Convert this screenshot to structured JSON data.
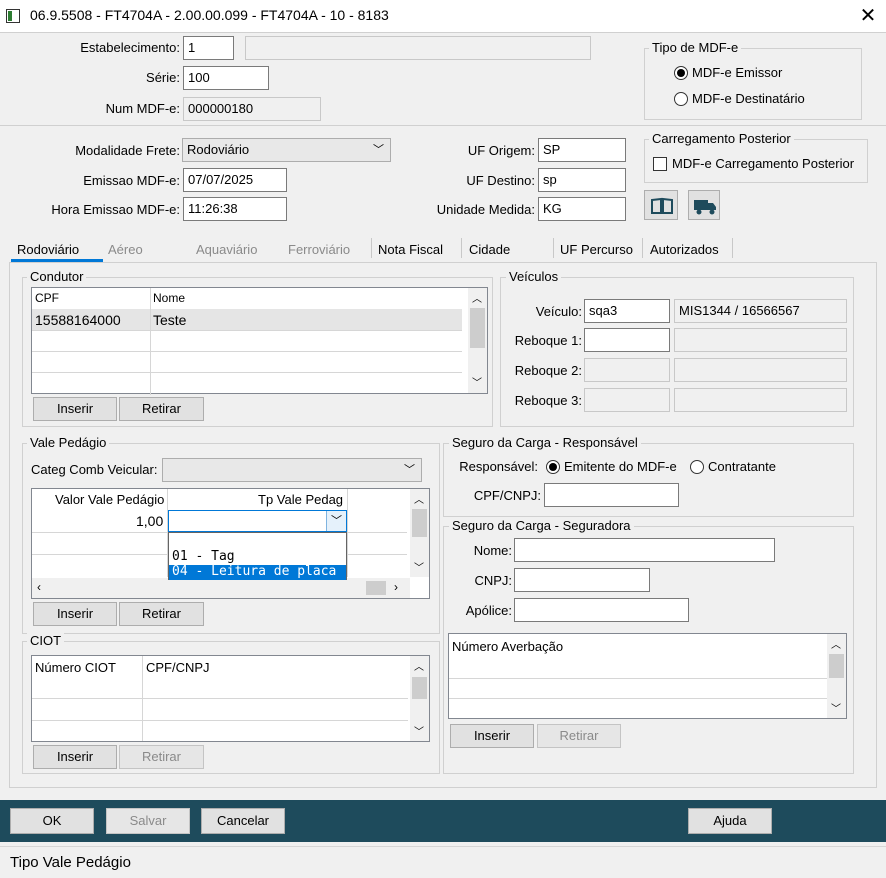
{
  "window": {
    "title": "06.9.5508 - FT4704A - 2.00.00.099 - FT4704A - 10 - 8183"
  },
  "header": {
    "estabelecimento_label": "Estabelecimento:",
    "estabelecimento_value": "1",
    "estabelecimento_desc": "",
    "serie_label": "Série:",
    "serie_value": "100",
    "num_mdfe_label": "Num MDF-e:",
    "num_mdfe_value": "000000180",
    "tipo_mdfe_title": "Tipo de MDF-e",
    "tipo_emissor": "MDF-e Emissor",
    "tipo_destinatario": "MDF-e Destinatário"
  },
  "details": {
    "modalidade_label": "Modalidade Frete:",
    "modalidade_value": "Rodoviário",
    "emissao_label": "Emissao MDF-e:",
    "emissao_value": "07/07/2025",
    "hora_label": "Hora Emissao MDF-e:",
    "hora_value": "11:26:38",
    "uf_origem_label": "UF Origem:",
    "uf_origem_value": "SP",
    "uf_destino_label": "UF Destino:",
    "uf_destino_value": "sp",
    "unidade_label": "Unidade Medida:",
    "unidade_value": "KG",
    "carreg_title": "Carregamento Posterior",
    "carreg_check_label": "MDF-e Carregamento Posterior"
  },
  "tabs": [
    {
      "label": "Rodoviário"
    },
    {
      "label": "Aéreo"
    },
    {
      "label": "Aquaviário"
    },
    {
      "label": "Ferroviário"
    },
    {
      "label": "Nota Fiscal"
    },
    {
      "label": "Cidade"
    },
    {
      "label": "UF Percurso"
    },
    {
      "label": "Autorizados"
    }
  ],
  "condutor": {
    "title": "Condutor",
    "columns": [
      "CPF",
      "Nome"
    ],
    "rows": [
      [
        "15588164000",
        "Teste"
      ]
    ],
    "inserir": "Inserir",
    "retirar": "Retirar"
  },
  "veiculos": {
    "title": "Veículos",
    "veiculo_label": "Veículo:",
    "veiculo_value": "sqa3",
    "veiculo_desc": "MIS1344 / 16566567",
    "reboque1_label": "Reboque 1:",
    "reboque2_label": "Reboque 2:",
    "reboque3_label": "Reboque 3:"
  },
  "vale_pedagio": {
    "title": "Vale Pedágio",
    "categ_label": "Categ Comb Veicular:",
    "columns": [
      "Valor Vale Pedágio",
      "Tp Vale Pedag"
    ],
    "row_value": "1,00",
    "dropdown_options": [
      "01 - Tag",
      "04 - Leitura de placa"
    ],
    "inserir": "Inserir",
    "retirar": "Retirar"
  },
  "seguro_resp": {
    "title": "Seguro da Carga - Responsável",
    "responsavel_label": "Responsável:",
    "opt_emitente": "Emitente do MDF-e",
    "opt_contratante": "Contratante",
    "cpf_cnpj_label": "CPF/CNPJ:"
  },
  "seguro_seg": {
    "title": "Seguro da Carga - Seguradora",
    "nome_label": "Nome:",
    "cnpj_label": "CNPJ:",
    "apolice_label": "Apólice:",
    "averbacao_col": "Número Averbação",
    "inserir": "Inserir",
    "retirar": "Retirar"
  },
  "ciot": {
    "title": "CIOT",
    "columns": [
      "Número CIOT",
      "CPF/CNPJ"
    ],
    "inserir": "Inserir",
    "retirar": "Retirar"
  },
  "footer": {
    "ok": "OK",
    "salvar": "Salvar",
    "cancelar": "Cancelar",
    "ajuda": "Ajuda"
  },
  "status": {
    "text": "Tipo Vale Pedágio"
  },
  "colors": {
    "footer_bar": "#1e4b5c",
    "tab_accent": "#0078d7",
    "selection": "#0078d7"
  }
}
